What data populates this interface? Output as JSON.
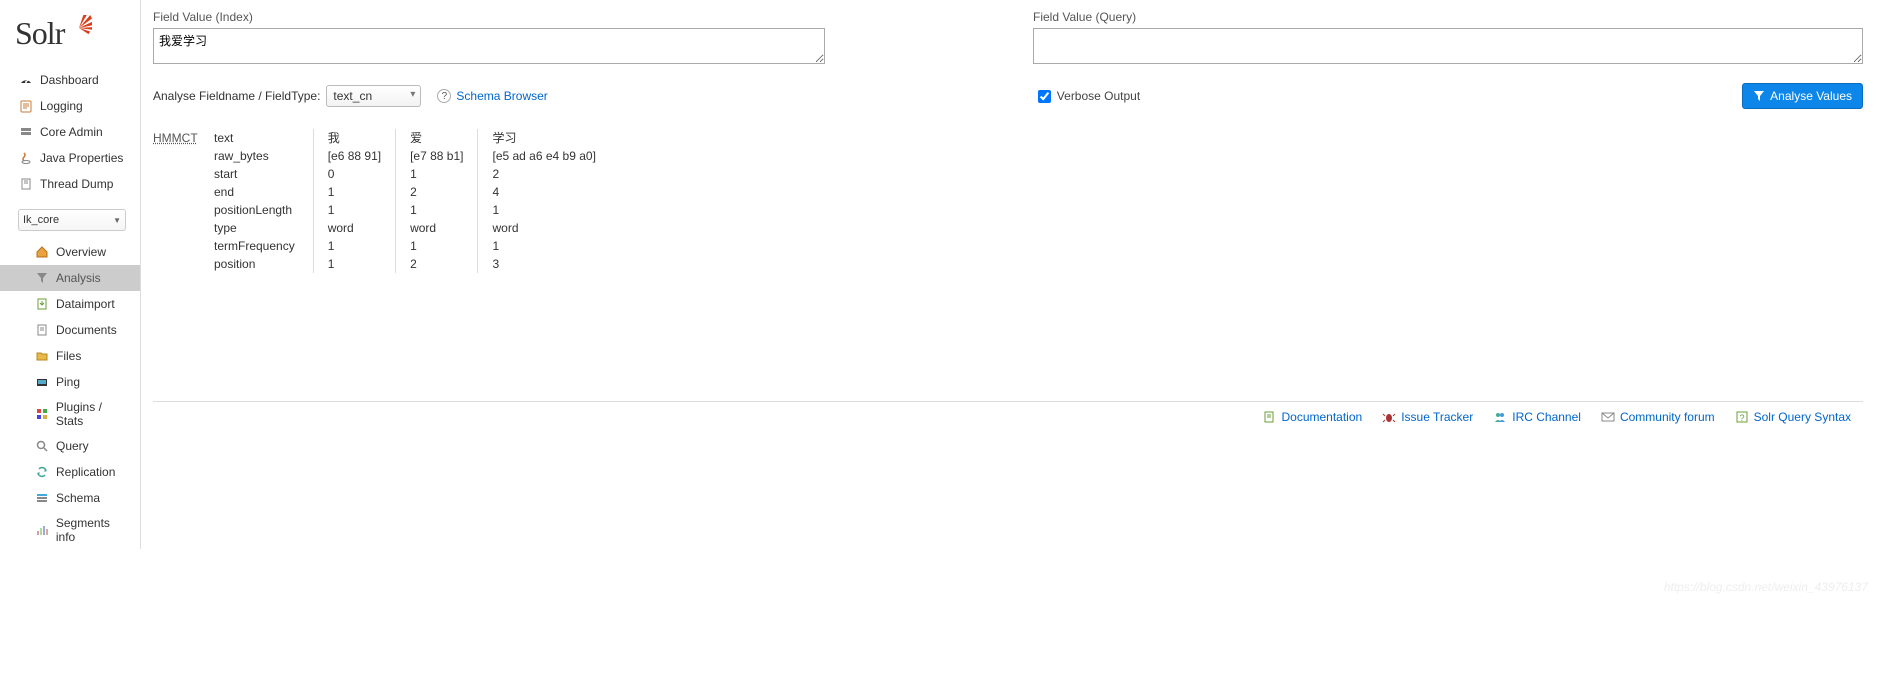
{
  "logo": {
    "text": "Solr"
  },
  "nav_main": [
    {
      "key": "dashboard",
      "label": "Dashboard"
    },
    {
      "key": "logging",
      "label": "Logging"
    },
    {
      "key": "core-admin",
      "label": "Core Admin"
    },
    {
      "key": "java-properties",
      "label": "Java Properties"
    },
    {
      "key": "thread-dump",
      "label": "Thread Dump"
    }
  ],
  "core_selector": {
    "value": "Ik_core"
  },
  "nav_sub": [
    {
      "key": "overview",
      "label": "Overview",
      "active": false
    },
    {
      "key": "analysis",
      "label": "Analysis",
      "active": true
    },
    {
      "key": "dataimport",
      "label": "Dataimport",
      "active": false
    },
    {
      "key": "documents",
      "label": "Documents",
      "active": false
    },
    {
      "key": "files",
      "label": "Files",
      "active": false
    },
    {
      "key": "ping",
      "label": "Ping",
      "active": false
    },
    {
      "key": "plugins-stats",
      "label": "Plugins / Stats",
      "active": false
    },
    {
      "key": "query",
      "label": "Query",
      "active": false
    },
    {
      "key": "replication",
      "label": "Replication",
      "active": false
    },
    {
      "key": "schema",
      "label": "Schema",
      "active": false
    },
    {
      "key": "segments-info",
      "label": "Segments info",
      "active": false
    }
  ],
  "field_index": {
    "label": "Field Value (Index)",
    "value": "我爱学习"
  },
  "field_query": {
    "label": "Field Value (Query)",
    "value": ""
  },
  "analyse": {
    "label": "Analyse Fieldname / FieldType:",
    "type_value": "text_cn",
    "schema_browser": "Schema Browser",
    "verbose": "Verbose Output",
    "verbose_checked": true,
    "button": "Analyse Values"
  },
  "result": {
    "tokenizer": "HMMCT",
    "attrs": [
      "text",
      "raw_bytes",
      "start",
      "end",
      "positionLength",
      "type",
      "termFrequency",
      "position"
    ],
    "tokens": [
      {
        "text": "我",
        "raw_bytes": "[e6 88 91]",
        "start": "0",
        "end": "1",
        "positionLength": "1",
        "type": "word",
        "termFrequency": "1",
        "position": "1"
      },
      {
        "text": "爱",
        "raw_bytes": "[e7 88 b1]",
        "start": "1",
        "end": "2",
        "positionLength": "1",
        "type": "word",
        "termFrequency": "1",
        "position": "2"
      },
      {
        "text": "学习",
        "raw_bytes": "[e5 ad a6 e4 b9 a0]",
        "start": "2",
        "end": "4",
        "positionLength": "1",
        "type": "word",
        "termFrequency": "1",
        "position": "3"
      }
    ]
  },
  "footer": [
    {
      "key": "documentation",
      "label": "Documentation"
    },
    {
      "key": "issue-tracker",
      "label": "Issue Tracker"
    },
    {
      "key": "irc-channel",
      "label": "IRC Channel"
    },
    {
      "key": "community-forum",
      "label": "Community forum"
    },
    {
      "key": "solr-query-syntax",
      "label": "Solr Query Syntax"
    }
  ],
  "watermark": "https://blog.csdn.net/weixin_43976137"
}
